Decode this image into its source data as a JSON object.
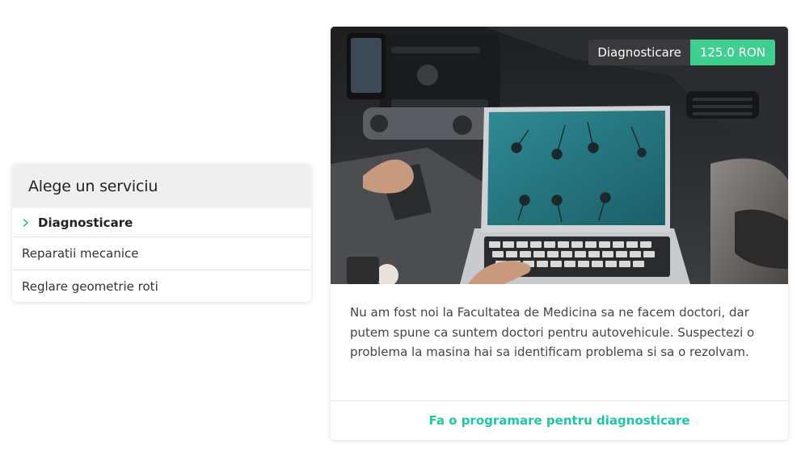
{
  "menu": {
    "title": "Alege un serviciu",
    "items": [
      {
        "label": "Diagnosticare",
        "active": true
      },
      {
        "label": "Reparatii mecanice",
        "active": false
      },
      {
        "label": "Reglare geometrie roti",
        "active": false
      }
    ]
  },
  "service": {
    "name": "Diagnosticare",
    "price": "125.0 RON",
    "description": "Nu am fost noi la Facultatea de Medicina sa ne facem doctori, dar putem spune ca suntem doctori pentru autovehicule. Suspectezi o problema la masina hai sa identificam problema si sa o rezolvam.",
    "cta_label": "Fa o programare pentru diagnosticare"
  },
  "colors": {
    "accent": "#1fc7a0",
    "price_badge": "#3fcf8e",
    "name_badge": "#3a3a3c"
  }
}
